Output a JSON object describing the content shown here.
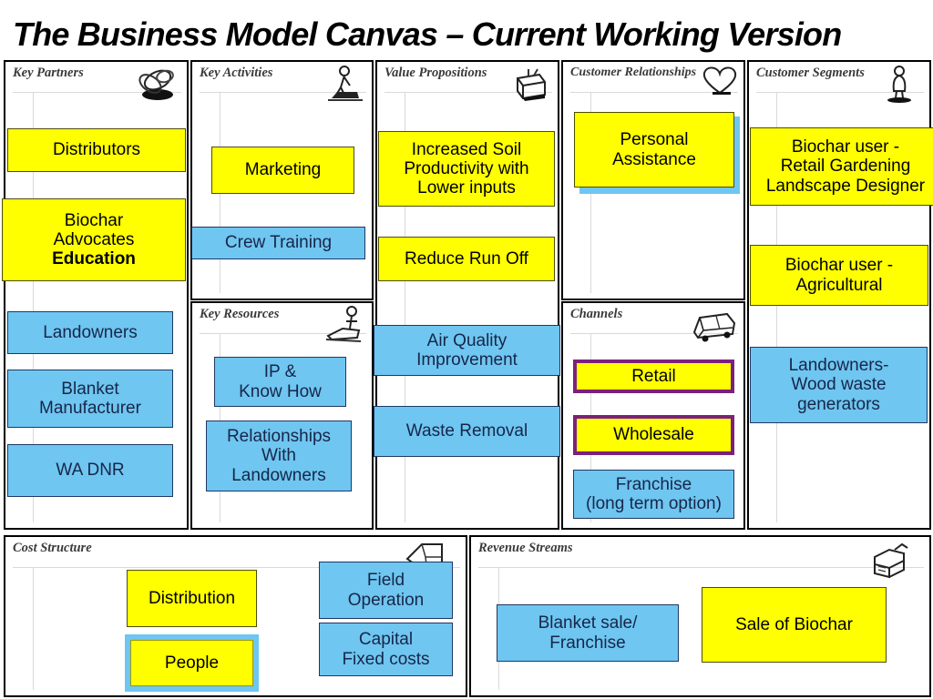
{
  "page": {
    "title": "The Business Model Canvas – Current Working Version",
    "colors": {
      "yellow": "#FFFF00",
      "blue": "#6FC6F0",
      "purple_border": "#7B217B",
      "navy_text": "#17264a",
      "border_black": "#000000"
    }
  },
  "sections": {
    "key_partners": {
      "header": "Key Partners",
      "icon": "chain-links-icon",
      "notes": [
        {
          "text": "Distributors",
          "style": "yellow"
        },
        {
          "text": "Biochar\nAdvocates",
          "bold_suffix": "Education",
          "style": "yellow"
        },
        {
          "text": "Landowners",
          "style": "blue"
        },
        {
          "text": "Blanket\nManufacturer",
          "style": "blue"
        },
        {
          "text": "WA DNR",
          "style": "blue"
        }
      ]
    },
    "key_activities": {
      "header": "Key Activities",
      "icon": "worker-pushing-cart-icon",
      "notes": [
        {
          "text": "Marketing",
          "style": "yellow"
        },
        {
          "text": "Crew Training",
          "style": "blue"
        }
      ]
    },
    "key_resources": {
      "header": "Key Resources",
      "icon": "machine-operator-icon",
      "notes": [
        {
          "text": "IP &\nKnow How",
          "style": "blue"
        },
        {
          "text": "Relationships\nWith\nLandowners",
          "style": "blue"
        }
      ]
    },
    "value_propositions": {
      "header": "Value Propositions",
      "icon": "gift-box-icon",
      "notes": [
        {
          "text": "Increased Soil\nProductivity with\nLower inputs",
          "style": "yellow"
        },
        {
          "text": "Reduce Run Off",
          "style": "yellow"
        },
        {
          "text": "Air Quality\nImprovement",
          "style": "blue"
        },
        {
          "text": "Waste Removal",
          "style": "blue"
        }
      ]
    },
    "customer_relationships": {
      "header": "Customer Relationships",
      "icon": "heart-icon",
      "notes": [
        {
          "text": "Personal\nAssistance",
          "style": "yellow-with-blue-shadow"
        }
      ]
    },
    "channels": {
      "header": "Channels",
      "icon": "delivery-truck-icon",
      "notes": [
        {
          "text": "Retail",
          "style": "yellow-purple-border"
        },
        {
          "text": "Wholesale",
          "style": "yellow-purple-border"
        },
        {
          "text": "Franchise\n(long term option)",
          "style": "blue"
        }
      ]
    },
    "customer_segments": {
      "header": "Customer Segments",
      "icon": "person-standing-icon",
      "notes": [
        {
          "text": "Biochar user -\nRetail Gardening\nLandscape Designer",
          "style": "yellow"
        },
        {
          "text": "Biochar user -\nAgricultural",
          "style": "yellow"
        },
        {
          "text": "Landowners-\nWood waste\ngenerators",
          "style": "blue"
        }
      ]
    },
    "cost_structure": {
      "header": "Cost Structure",
      "icon": "price-tag-icon",
      "notes": [
        {
          "text": "Distribution",
          "style": "yellow"
        },
        {
          "text": "People",
          "style": "yellow-blue-halo"
        },
        {
          "text": "Field\nOperation",
          "style": "blue"
        },
        {
          "text": "Capital\nFixed costs",
          "style": "blue"
        }
      ]
    },
    "revenue_streams": {
      "header": "Revenue Streams",
      "icon": "cash-register-icon",
      "notes": [
        {
          "text": "Blanket sale/\nFranchise",
          "style": "blue"
        },
        {
          "text": "Sale of Biochar",
          "style": "yellow"
        }
      ]
    }
  }
}
